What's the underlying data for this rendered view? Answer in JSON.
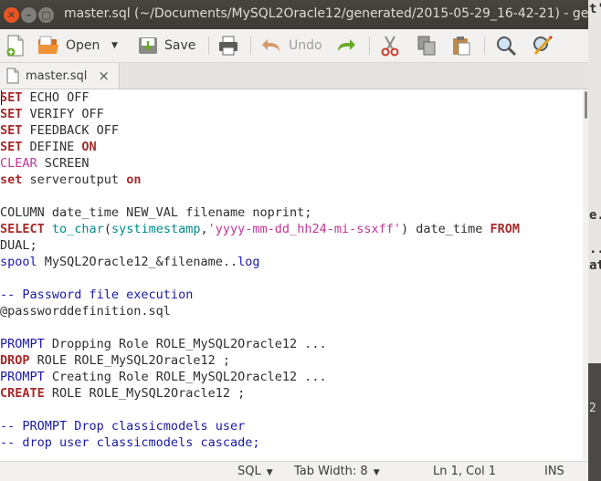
{
  "window": {
    "title": "master.sql (~/Documents/MySQL2Oracle12/generated/2015-05-29_16-42-21) - gec"
  },
  "toolbar": {
    "open_label": "Open",
    "save_label": "Save",
    "undo_label": "Undo"
  },
  "tab": {
    "label": "master.sql",
    "close": "×"
  },
  "editor": {
    "lines": [
      [
        {
          "t": "SET",
          "c": "kw"
        },
        {
          "t": " ECHO OFF",
          "c": ""
        }
      ],
      [
        {
          "t": "SET",
          "c": "kw"
        },
        {
          "t": " VERIFY OFF",
          "c": ""
        }
      ],
      [
        {
          "t": "SET",
          "c": "kw"
        },
        {
          "t": " FEEDBACK OFF",
          "c": ""
        }
      ],
      [
        {
          "t": "SET",
          "c": "kw"
        },
        {
          "t": " DEFINE ",
          "c": ""
        },
        {
          "t": "ON",
          "c": "kw"
        }
      ],
      [
        {
          "t": "CLEAR",
          "c": "pk"
        },
        {
          "t": " SCREEN",
          "c": ""
        }
      ],
      [
        {
          "t": "set",
          "c": "kw"
        },
        {
          "t": " serveroutput ",
          "c": ""
        },
        {
          "t": "on",
          "c": "kw"
        }
      ],
      [],
      [
        {
          "t": "COLUMN date_time NEW_VAL filename noprint;",
          "c": ""
        }
      ],
      [
        {
          "t": "SELECT",
          "c": "kw"
        },
        {
          "t": " ",
          "c": ""
        },
        {
          "t": "to_char",
          "c": "tl"
        },
        {
          "t": "(",
          "c": ""
        },
        {
          "t": "systimestamp",
          "c": "tl"
        },
        {
          "t": ",",
          "c": ""
        },
        {
          "t": "'yyyy-mm-dd_hh24-mi-ssxff'",
          "c": "pk"
        },
        {
          "t": ") date_time ",
          "c": ""
        },
        {
          "t": "FROM",
          "c": "kw"
        }
      ],
      [
        {
          "t": "DUAL;",
          "c": ""
        }
      ],
      [
        {
          "t": "spool",
          "c": "bl"
        },
        {
          "t": " MySQL2Oracle12_&filename..",
          "c": ""
        },
        {
          "t": "log",
          "c": "bl"
        }
      ],
      [],
      [
        {
          "t": "-- Password file execution",
          "c": "cm"
        }
      ],
      [
        {
          "t": "@passworddefinition.sql",
          "c": ""
        }
      ],
      [],
      [
        {
          "t": "PROMPT",
          "c": "bl"
        },
        {
          "t": " Dropping Role ROLE_MySQL2Oracle12 ...",
          "c": ""
        }
      ],
      [
        {
          "t": "DROP",
          "c": "kw"
        },
        {
          "t": " ROLE ROLE_MySQL2Oracle12 ;",
          "c": ""
        }
      ],
      [
        {
          "t": "PROMPT",
          "c": "bl"
        },
        {
          "t": " Creating Role ROLE_MySQL2Oracle12 ...",
          "c": ""
        }
      ],
      [
        {
          "t": "CREATE",
          "c": "kw"
        },
        {
          "t": " ROLE ROLE_MySQL2Oracle12 ;",
          "c": ""
        }
      ],
      [],
      [
        {
          "t": "-- PROMPT Drop classicmodels user",
          "c": "cm"
        }
      ],
      [
        {
          "t": "-- drop user classicmodels cascade;",
          "c": "cm"
        }
      ]
    ]
  },
  "statusbar": {
    "language": "SQL",
    "tab_width": "Tab Width: 8",
    "position": "Ln 1, Col 1",
    "mode": "INS"
  },
  "background_fragments": [
    "t'",
    "e.",
    "..",
    "at",
    "2"
  ],
  "colors": {
    "keyword": "#a52a2a",
    "builtin": "#1a1aa6",
    "function": "#008b8b",
    "string": "#c4359a",
    "titlebar": "#3c3b37",
    "close_button": "#e95420"
  }
}
